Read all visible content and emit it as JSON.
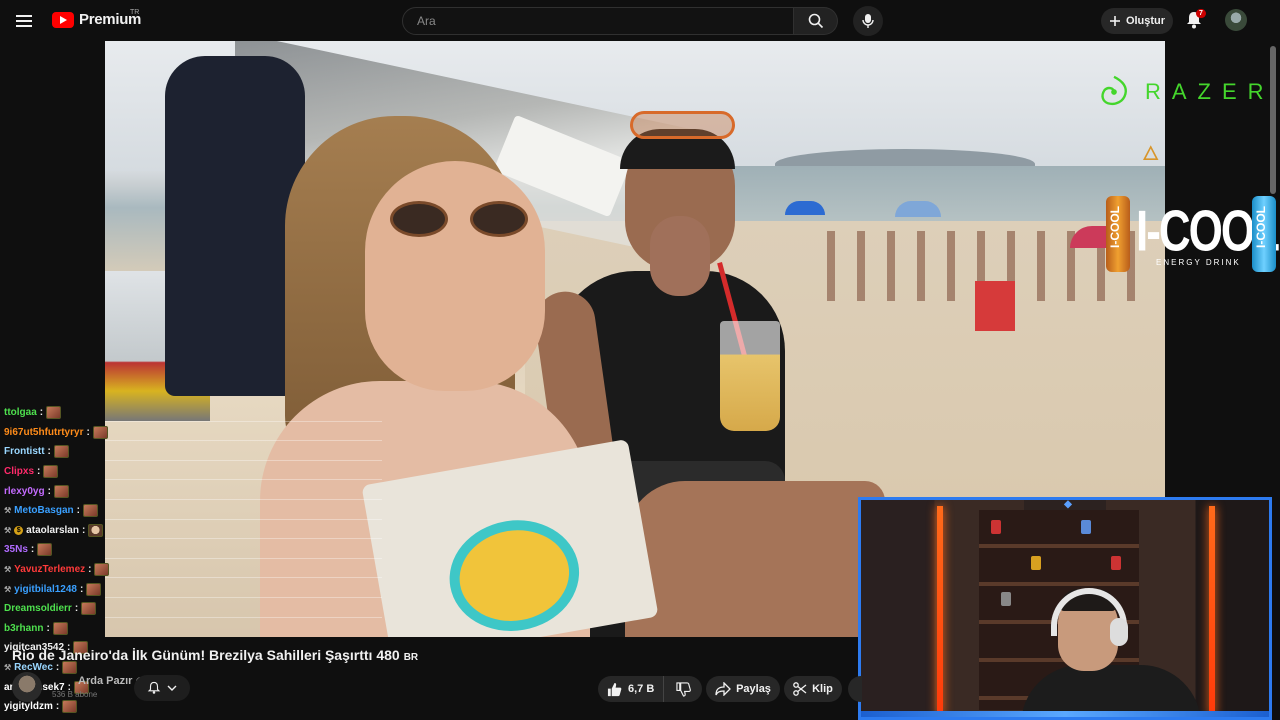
{
  "header": {
    "logo_text": "Premium",
    "region": "TR",
    "search_placeholder": "Ara",
    "create_label": "Oluştur",
    "notification_count": "7"
  },
  "overlay": {
    "sponsor_razer": "RAZER",
    "sponsor_icool": "I-COOL",
    "icool_tagline": "ENERGY DRINK",
    "can_text": "I-COOL"
  },
  "chat": [
    {
      "user": "ttolgaa",
      "color": "#4ee04e"
    },
    {
      "user": "9i67ut5hfutrtyryr",
      "color": "#ff8c1a"
    },
    {
      "user": "Frontistt",
      "color": "#9ad7ff"
    },
    {
      "user": "Clipxs",
      "color": "#ff2a6a"
    },
    {
      "user": "rlexy0yg",
      "color": "#c46bff"
    },
    {
      "user": "MetoBasgan",
      "color": "#3aa0ff"
    },
    {
      "user": "ataolarslan",
      "color": "#f1f1f1"
    },
    {
      "user": "35Ns",
      "color": "#b06bff"
    },
    {
      "user": "YavuzTerlemez",
      "color": "#ff3a3a"
    },
    {
      "user": "yigitbilal1248",
      "color": "#3aa0ff"
    },
    {
      "user": "Dreamsoldierr",
      "color": "#4ee04e"
    },
    {
      "user": "b3rhann",
      "color": "#4ee04e"
    },
    {
      "user": "yigitcan3542",
      "color": "#f1f1f1"
    },
    {
      "user": "RecWec",
      "color": "#9ad7ff"
    },
    {
      "user": "ardasimsek7",
      "color": "#ffffff"
    },
    {
      "user": "yigityldzm",
      "color": "#ffffff"
    }
  ],
  "video": {
    "title": "Rio de Janeiro'da İlk Günüm! Brezilya Sahilleri Şaşırttı 480",
    "title_suffix": "BR",
    "channel_name": "Arda Pazır",
    "subscribers": "536 B abone",
    "likes": "6,7 B",
    "share_label": "Paylaş",
    "clip_label": "Klip"
  },
  "colors": {
    "accent": "#ff0000",
    "razer_green": "#44d62c",
    "webcam_border": "#2d7bf0"
  }
}
